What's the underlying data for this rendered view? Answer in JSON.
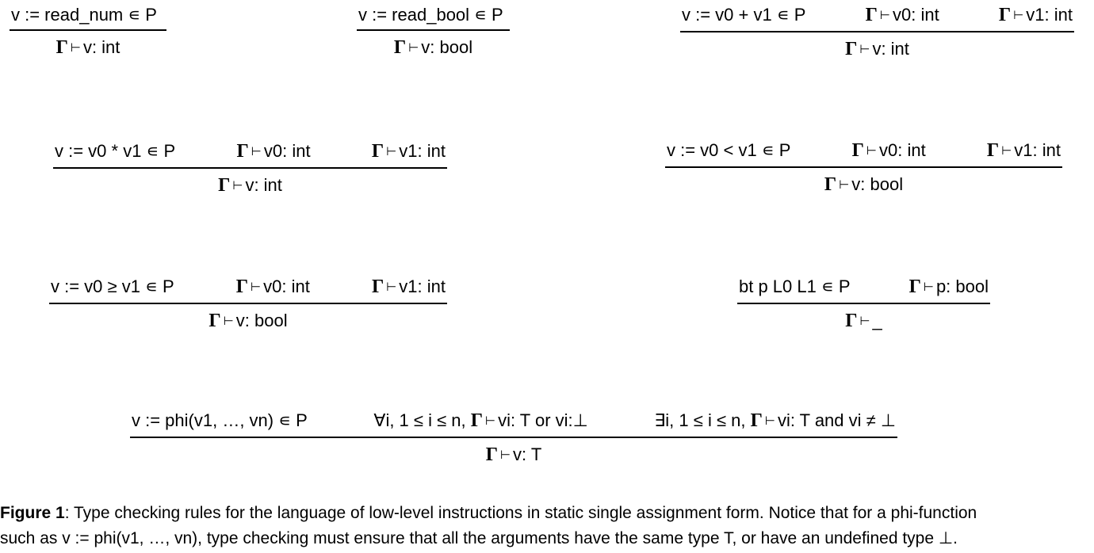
{
  "gamma": "Γ",
  "turnstile": "⊢",
  "rules": [
    {
      "premises": [
        {
          "text": "v := read_num ∊ P"
        }
      ],
      "conclusion": {
        "gamma": true,
        "text": "v: int"
      }
    },
    {
      "premises": [
        {
          "text": "v := read_bool ∊ P"
        }
      ],
      "conclusion": {
        "gamma": true,
        "text": "v: bool"
      }
    },
    {
      "premises": [
        {
          "text": "v := v0 + v1 ∊ P"
        },
        {
          "gamma": true,
          "text": "v0: int"
        },
        {
          "gamma": true,
          "text": "v1: int"
        }
      ],
      "conclusion": {
        "gamma": true,
        "text": "v: int"
      }
    },
    {
      "premises": [
        {
          "text": "v := v0 * v1 ∊ P"
        },
        {
          "gamma": true,
          "text": "v0: int"
        },
        {
          "gamma": true,
          "text": "v1: int"
        }
      ],
      "conclusion": {
        "gamma": true,
        "text": "v: int"
      }
    },
    {
      "premises": [
        {
          "text": "v := v0 < v1 ∊ P"
        },
        {
          "gamma": true,
          "text": "v0: int"
        },
        {
          "gamma": true,
          "text": "v1: int"
        }
      ],
      "conclusion": {
        "gamma": true,
        "text": "v: bool"
      }
    },
    {
      "premises": [
        {
          "text": "v := v0 ≥ v1 ∊ P"
        },
        {
          "gamma": true,
          "text": "v0: int"
        },
        {
          "gamma": true,
          "text": "v1: int"
        }
      ],
      "conclusion": {
        "gamma": true,
        "text": "v: bool"
      }
    },
    {
      "premises": [
        {
          "text": "bt p L0 L1 ∊ P"
        },
        {
          "gamma": true,
          "text": "p: bool"
        }
      ],
      "conclusion": {
        "gamma": true,
        "text": "_"
      }
    },
    {
      "premises": [
        {
          "text": "v := phi(v1, …, vn) ∊ P"
        },
        {
          "text": "∀i, 1 ≤ i ≤ n, ",
          "gamma_mid": true,
          "after": "vi: T or vi:⊥"
        },
        {
          "text": "∃i, 1 ≤ i ≤ n, ",
          "gamma_mid": true,
          "after": "vi: T and vi ≠ ⊥"
        }
      ],
      "conclusion": {
        "gamma": true,
        "text": "v: T"
      }
    }
  ],
  "caption": {
    "label": "Figure 1",
    "line1": ": Type checking rules for the language of low-level instructions in static single assignment form. Notice that for a phi-function",
    "line2": "such as v := phi(v1, …, vn), type checking must ensure that all the arguments have the same type T, or have an undefined type ⊥."
  }
}
